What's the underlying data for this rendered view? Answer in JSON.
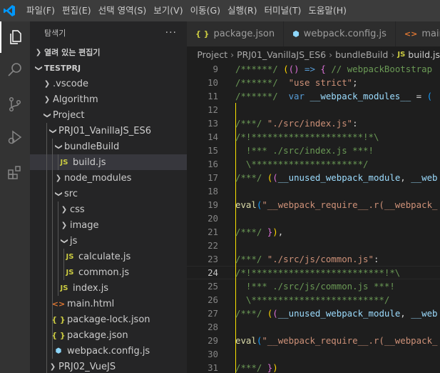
{
  "menubar": {
    "items": [
      "파일(F)",
      "편집(E)",
      "선택 영역(S)",
      "보기(V)",
      "이동(G)",
      "실행(R)",
      "터미널(T)",
      "도움말(H)"
    ]
  },
  "activity": [
    "explorer-icon",
    "search-icon",
    "source-control-icon",
    "run-debug-icon",
    "extensions-icon"
  ],
  "sidebar": {
    "title": "탐색기",
    "more": "···",
    "open_editors": "열려 있는 편집기",
    "root": "TESTPRJ",
    "tree": [
      {
        "label": ".vscode",
        "type": "folder",
        "expanded": false,
        "depth": 1
      },
      {
        "label": "Algorithm",
        "type": "folder",
        "expanded": false,
        "depth": 1
      },
      {
        "label": "Project",
        "type": "folder",
        "expanded": true,
        "depth": 1
      },
      {
        "label": "PRJ01_VanillaJS_ES6",
        "type": "folder",
        "expanded": true,
        "depth": 2
      },
      {
        "label": "bundleBuild",
        "type": "folder",
        "expanded": true,
        "depth": 3
      },
      {
        "label": "build.js",
        "type": "js",
        "depth": 4,
        "selected": true
      },
      {
        "label": "node_modules",
        "type": "folder",
        "expanded": false,
        "depth": 3
      },
      {
        "label": "src",
        "type": "folder",
        "expanded": true,
        "depth": 3
      },
      {
        "label": "css",
        "type": "folder",
        "expanded": false,
        "depth": 4
      },
      {
        "label": "image",
        "type": "folder",
        "expanded": false,
        "depth": 4
      },
      {
        "label": "js",
        "type": "folder",
        "expanded": true,
        "depth": 4
      },
      {
        "label": "calculate.js",
        "type": "js",
        "depth": 5
      },
      {
        "label": "common.js",
        "type": "js",
        "depth": 5
      },
      {
        "label": "index.js",
        "type": "js",
        "depth": 4
      },
      {
        "label": "main.html",
        "type": "html",
        "depth": 3
      },
      {
        "label": "package-lock.json",
        "type": "json",
        "depth": 3
      },
      {
        "label": "package.json",
        "type": "json",
        "depth": 3
      },
      {
        "label": "webpack.config.js",
        "type": "wp",
        "depth": 3
      },
      {
        "label": "PRJ02_VueJS",
        "type": "folder",
        "expanded": false,
        "depth": 2
      }
    ]
  },
  "tabs": [
    {
      "label": "package.json",
      "icon": "{ }",
      "kind": "json"
    },
    {
      "label": "webpack.config.js",
      "icon": "⬢",
      "kind": "wp"
    },
    {
      "label": "main",
      "icon": "<>",
      "kind": "html"
    }
  ],
  "breadcrumb": [
    "Project",
    "PRJ01_VanillaJS_ES6",
    "bundleBuild",
    "JS",
    "build.js"
  ],
  "editor": {
    "current_line": 24,
    "lines": [
      {
        "n": 9,
        "tokens": [
          [
            "c-com",
            "/******/ "
          ],
          [
            "c-br1",
            "("
          ],
          [
            "c-br2",
            "("
          ],
          [
            "c-br2",
            ")"
          ],
          [
            "c-key",
            " => "
          ],
          [
            "c-br2",
            "{"
          ],
          [
            "c-com",
            " // webpackBootstrap"
          ]
        ]
      },
      {
        "n": 10,
        "tokens": [
          [
            "c-com",
            "/******/ "
          ],
          [
            "c-str",
            " \"use strict\""
          ],
          [
            "c-pun",
            ";"
          ]
        ]
      },
      {
        "n": 11,
        "tokens": [
          [
            "c-com",
            "/******/ "
          ],
          [
            "c-key",
            " var "
          ],
          [
            "c-var",
            "__webpack_modules__"
          ],
          [
            "c-pun",
            " = "
          ],
          [
            "c-br3",
            "("
          ]
        ]
      },
      {
        "n": 12,
        "tokens": []
      },
      {
        "n": 13,
        "tokens": [
          [
            "c-com",
            "/***/ "
          ],
          [
            "c-str",
            "\"./src/index.js\""
          ],
          [
            "c-pun",
            ":"
          ]
        ]
      },
      {
        "n": 14,
        "tokens": [
          [
            "c-com",
            "/*!*********************!*\\"
          ]
        ]
      },
      {
        "n": 15,
        "tokens": [
          [
            "c-com",
            "  !*** ./src/index.js ***!"
          ]
        ]
      },
      {
        "n": 16,
        "tokens": [
          [
            "c-com",
            "  \\*********************/"
          ]
        ]
      },
      {
        "n": 17,
        "tokens": [
          [
            "c-com",
            "/***/ "
          ],
          [
            "c-br1",
            "("
          ],
          [
            "c-br2",
            "("
          ],
          [
            "c-var",
            "__unused_webpack_module"
          ],
          [
            "c-pun",
            ", "
          ],
          [
            "c-var",
            "__web"
          ]
        ]
      },
      {
        "n": 18,
        "tokens": []
      },
      {
        "n": 19,
        "tokens": [
          [
            "c-fn",
            "eval"
          ],
          [
            "c-br3",
            "("
          ],
          [
            "c-str",
            "\"__webpack_require__.r(__webpack_"
          ]
        ]
      },
      {
        "n": 20,
        "tokens": []
      },
      {
        "n": 21,
        "tokens": [
          [
            "c-com",
            "/***/ "
          ],
          [
            "c-br2",
            "}"
          ],
          [
            "c-br1",
            ")"
          ],
          [
            "c-pun",
            ","
          ]
        ]
      },
      {
        "n": 22,
        "tokens": []
      },
      {
        "n": 23,
        "tokens": [
          [
            "c-com",
            "/***/ "
          ],
          [
            "c-str",
            "\"./src/js/common.js\""
          ],
          [
            "c-pun",
            ":"
          ]
        ]
      },
      {
        "n": 24,
        "tokens": [
          [
            "c-com",
            "/*!*************************!*\\"
          ]
        ]
      },
      {
        "n": 25,
        "tokens": [
          [
            "c-com",
            "  !*** ./src/js/common.js ***!"
          ]
        ]
      },
      {
        "n": 26,
        "tokens": [
          [
            "c-com",
            "  \\*************************/"
          ]
        ]
      },
      {
        "n": 27,
        "tokens": [
          [
            "c-com",
            "/***/ "
          ],
          [
            "c-br1",
            "("
          ],
          [
            "c-br2",
            "("
          ],
          [
            "c-var",
            "__unused_webpack_module"
          ],
          [
            "c-pun",
            ", "
          ],
          [
            "c-var",
            "__web"
          ]
        ]
      },
      {
        "n": 28,
        "tokens": []
      },
      {
        "n": 29,
        "tokens": [
          [
            "c-fn",
            "eval"
          ],
          [
            "c-br3",
            "("
          ],
          [
            "c-str",
            "\"__webpack_require__.r(__webpack_"
          ]
        ]
      },
      {
        "n": 30,
        "tokens": []
      },
      {
        "n": 31,
        "tokens": [
          [
            "c-com",
            "/***/ "
          ],
          [
            "c-br2",
            "}"
          ],
          [
            "c-br1",
            ")"
          ]
        ]
      }
    ]
  },
  "colors": {
    "accent": "#007acc",
    "selection": "#37373d",
    "bracket_highlight": "#fbe400"
  }
}
